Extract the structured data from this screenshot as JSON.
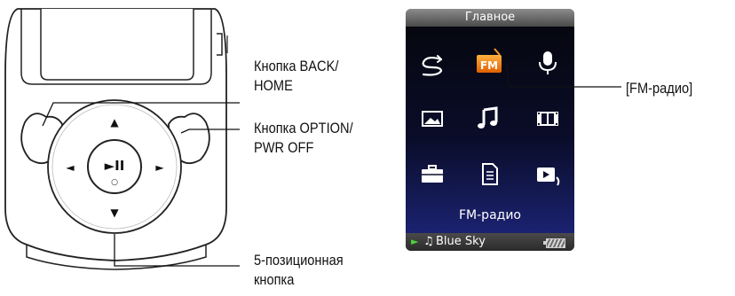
{
  "labels": {
    "back_home": [
      "Кнопка BACK/",
      "HOME"
    ],
    "option_pwr": [
      "Кнопка OPTION/",
      "PWR OFF"
    ],
    "five_way": [
      "5-позиционная",
      "кнопка"
    ],
    "fm_radio": "[FM-радио]"
  },
  "screen": {
    "title": "Главное",
    "icons": [
      "shuffle-icon",
      "fm-radio-icon",
      "microphone-icon",
      "photo-icon",
      "music-note-icon",
      "video-film-icon",
      "toolbox-icon",
      "document-icon",
      "now-playing-icon"
    ],
    "fm_badge": "FM",
    "caption": "FM-радио",
    "status_play": "►",
    "status_note": "♫",
    "status_track": "Blue Sky",
    "accent": "#f07a10"
  },
  "device": {
    "up_arrow": "▲",
    "down_arrow": "▼",
    "left_arrow": "◄",
    "right_arrow": "►",
    "play_pause": "►II",
    "center_dot": "○"
  }
}
